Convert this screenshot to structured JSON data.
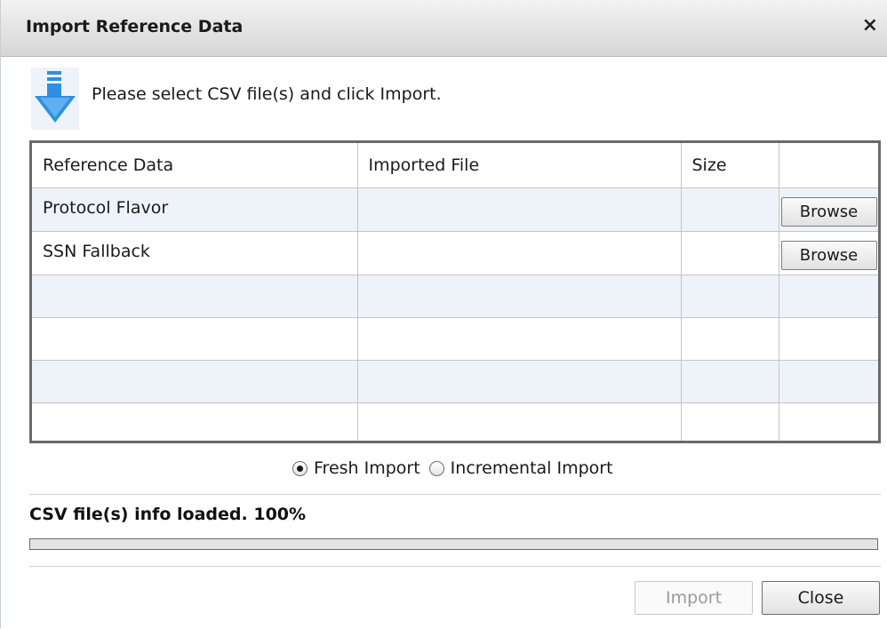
{
  "dialog": {
    "title": "Import Reference Data",
    "close_glyph": "×",
    "instruction": "Please select CSV file(s) and click Import.",
    "instruction_icon": "import-arrow-down-icon"
  },
  "table": {
    "columns": [
      "Reference Data",
      "Imported File",
      "Size",
      ""
    ],
    "rows": [
      {
        "reference": "Protocol Flavor",
        "file": "",
        "size": "",
        "action": "Browse"
      },
      {
        "reference": "SSN Fallback",
        "file": "",
        "size": "",
        "action": "Browse"
      },
      {
        "reference": "",
        "file": "",
        "size": "",
        "action": ""
      },
      {
        "reference": "",
        "file": "",
        "size": "",
        "action": ""
      },
      {
        "reference": "",
        "file": "",
        "size": "",
        "action": ""
      },
      {
        "reference": "",
        "file": "",
        "size": "",
        "action": ""
      }
    ]
  },
  "import_mode": {
    "options": [
      {
        "label": "Fresh Import",
        "selected": true
      },
      {
        "label": "Incremental Import",
        "selected": false
      }
    ]
  },
  "status": {
    "text": "CSV file(s) info loaded. 100%",
    "progress_percent": 100
  },
  "buttons": {
    "import_label": "Import",
    "import_enabled": false,
    "close_label": "Close"
  },
  "colors": {
    "alt_row": "#eef3f9",
    "icon_blue": "#2f8fe0",
    "disabled_text": "#9a9a9a"
  }
}
